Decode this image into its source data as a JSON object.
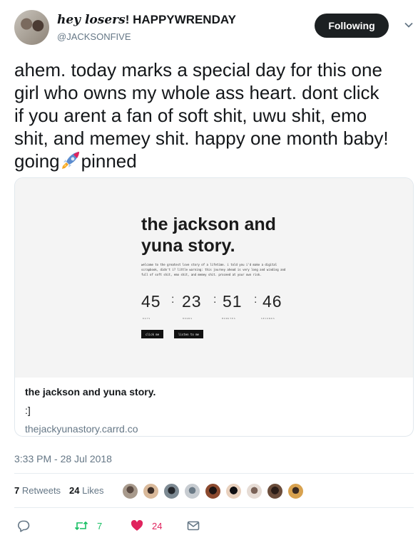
{
  "author": {
    "display_name_script": "hey losers",
    "display_name_rest": "! HAPPYWRENDAY",
    "handle": "@JACKSONFIVE",
    "follow_label": "Following"
  },
  "tweet": {
    "text_line1": "ahem. today marks a special day for this one",
    "text_line2": "girl who owns my whole ass heart. dont click",
    "text_line3": "if you arent a fan of soft shit, uwu shit, emo",
    "text_line4": "shit, and memey shit. happy one month baby!",
    "text_line5a": "going",
    "text_line5b": "pinned",
    "emoji": "rocket-icon"
  },
  "card": {
    "preview": {
      "title_line1": "the jackson and",
      "title_line2": "yuna story",
      "title_dot": ".",
      "description": "welcome to the greatest love story of a lifetime. i told you i'd make a digital scrapbook, didn't i? little warning: this journey ahead is very long and winding and full of soft shit, emo shit, and memey shit. proceed at your own risk.",
      "countdown": {
        "days": "45",
        "hours": "23",
        "minutes": "51",
        "seconds": "46",
        "sep": ":",
        "days_label": "DAYS",
        "hours_label": "HOURS",
        "minutes_label": "MINUTES",
        "seconds_label": "SECONDS"
      },
      "button1": "click me",
      "button2": "listen to me"
    },
    "title": "the jackson and yuna story.",
    "description": ":]",
    "domain": "thejackyunastory.carrd.co"
  },
  "timestamp": "3:33 PM - 28 Jul 2018",
  "stats": {
    "retweets_count": "7",
    "retweets_label": "Retweets",
    "likes_count": "24",
    "likes_label": "Likes"
  },
  "actions": {
    "reply_icon": "reply-icon",
    "retweet_icon": "retweet-icon",
    "retweet_count": "7",
    "like_icon": "heart-icon",
    "like_count": "24",
    "dm_icon": "envelope-icon"
  },
  "colors": {
    "retweet": "#17bf63",
    "like": "#e0245e",
    "muted": "#657786",
    "follow_bg": "#1c2022"
  }
}
